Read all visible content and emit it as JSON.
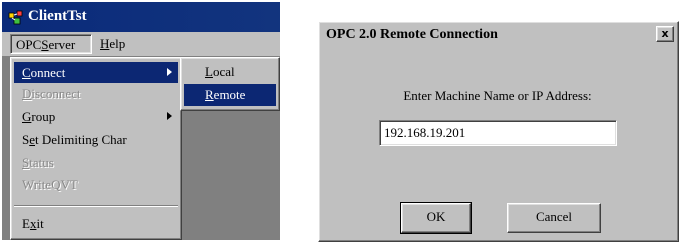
{
  "left_window": {
    "title": "ClientTst",
    "title_icon": "app-icon",
    "menubar": [
      {
        "pre": "OPC",
        "accel": "S",
        "post": "erver"
      },
      {
        "pre": "",
        "accel": "H",
        "post": "elp"
      }
    ],
    "dropdown": [
      {
        "pre": "",
        "accel": "C",
        "post": "onnect",
        "disabled": false,
        "submenu": true
      },
      {
        "pre": "",
        "accel": "D",
        "post": "isconnect",
        "disabled": true,
        "submenu": false
      },
      {
        "pre": "",
        "accel": "G",
        "post": "roup",
        "disabled": false,
        "submenu": true
      },
      {
        "pre": "S",
        "accel": "e",
        "post": "t Delimiting Char",
        "disabled": false,
        "submenu": false
      },
      {
        "pre": "",
        "accel": "S",
        "post": "tatus",
        "disabled": true,
        "submenu": false
      },
      {
        "pre": "",
        "accel": "",
        "post": "WriteQVT",
        "disabled": true,
        "submenu": false
      },
      {
        "pre": "E",
        "accel": "x",
        "post": "it",
        "disabled": false,
        "submenu": false
      }
    ],
    "submenu": [
      {
        "pre": "",
        "accel": "L",
        "post": "ocal"
      },
      {
        "pre": "",
        "accel": "R",
        "post": "emote"
      }
    ],
    "colors": {
      "titlebar": "#0a2a7a",
      "highlight": "#0c2773",
      "workspace": "#808080"
    }
  },
  "dialog": {
    "title": "OPC 2.0 Remote Connection",
    "close_label": "x",
    "label": "Enter Machine Name or IP Address:",
    "address_value": "192.168.19.201",
    "ok_label": "OK",
    "cancel_label": "Cancel"
  }
}
